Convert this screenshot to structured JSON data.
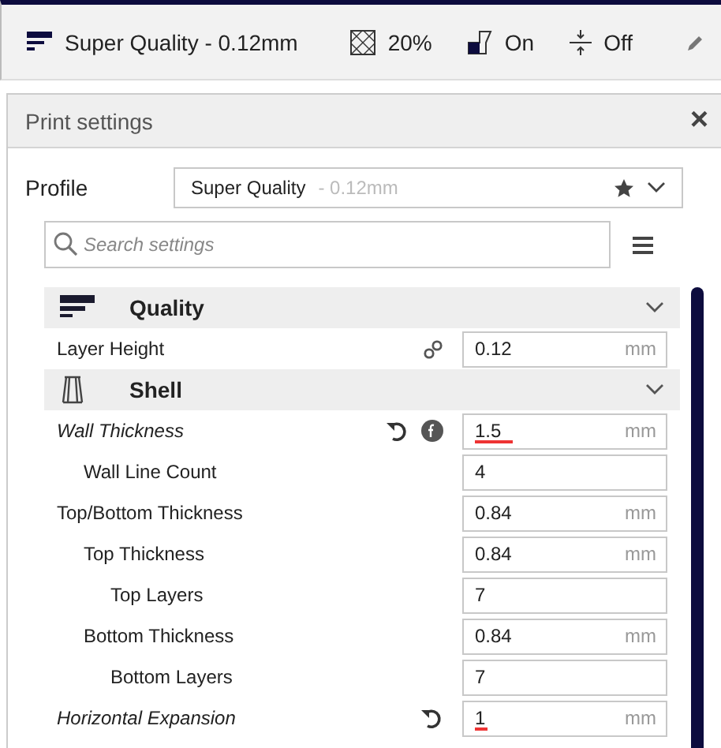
{
  "top_bar": {
    "profile": "Super Quality - 0.12mm",
    "infill": "20%",
    "support": "On",
    "adhesion": "Off"
  },
  "panel": {
    "title": "Print settings",
    "close": "×",
    "profile": {
      "label": "Profile",
      "name": "Super Quality",
      "detail": " - 0.12mm"
    },
    "search": {
      "placeholder": "Search settings"
    },
    "settings": [
      {
        "kind": "category",
        "label": "Quality",
        "expanded": true
      },
      {
        "kind": "setting",
        "label": "Layer Height",
        "value": "0.12",
        "unit": "mm",
        "modified": false,
        "linked": true,
        "formula": false,
        "flagged": false
      },
      {
        "kind": "category",
        "label": "Shell",
        "expanded": true
      },
      {
        "kind": "setting",
        "label": "Wall Thickness",
        "value": "1.5",
        "unit": "mm",
        "modified": true,
        "linked": false,
        "formula": true,
        "flagged": true,
        "children": [
          {
            "kind": "setting",
            "label": "Wall Line Count",
            "value": "4",
            "modified": false,
            "linked": false,
            "formula": false,
            "flagged": false
          }
        ]
      },
      {
        "kind": "setting",
        "label": "Top/Bottom Thickness",
        "value": "0.84",
        "unit": "mm",
        "modified": false,
        "linked": false,
        "formula": false,
        "flagged": false,
        "children": [
          {
            "kind": "setting",
            "label": "Top Thickness",
            "value": "0.84",
            "unit": "mm",
            "modified": false,
            "linked": false,
            "formula": false,
            "flagged": false,
            "children": [
              {
                "kind": "setting",
                "label": "Top Layers",
                "value": "7",
                "modified": false,
                "linked": false,
                "formula": false,
                "flagged": false
              }
            ]
          },
          {
            "kind": "setting",
            "label": "Bottom Thickness",
            "value": "0.84",
            "unit": "mm",
            "modified": false,
            "linked": false,
            "formula": false,
            "flagged": false,
            "children": [
              {
                "kind": "setting",
                "label": "Bottom Layers",
                "value": "7",
                "modified": false,
                "linked": false,
                "formula": false,
                "flagged": false
              }
            ]
          }
        ]
      },
      {
        "kind": "setting",
        "label": "Horizontal Expansion",
        "value": "1",
        "unit": "mm",
        "modified": true,
        "linked": false,
        "formula": false,
        "flagged": true
      }
    ]
  }
}
